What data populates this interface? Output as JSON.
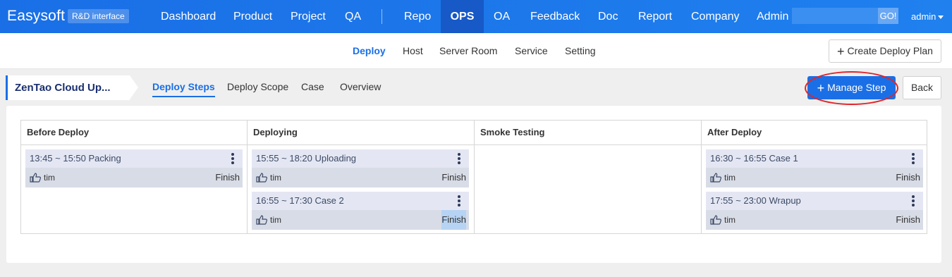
{
  "brand": {
    "name": "Easysoft",
    "badge": "R&D interface"
  },
  "nav": {
    "items": [
      "Dashboard",
      "Product",
      "Project",
      "QA",
      "Repo",
      "OPS",
      "OA",
      "Feedback",
      "Doc",
      "Report",
      "Company",
      "Admin"
    ],
    "active": "OPS",
    "search_go": "GO!",
    "user": "admin"
  },
  "subnav": {
    "items": [
      "Deploy",
      "Host",
      "Server Room",
      "Service",
      "Setting"
    ],
    "active": "Deploy",
    "create_button": "Create Deploy Plan"
  },
  "plan": {
    "title": "ZenTao Cloud Up...",
    "tabs": [
      "Deploy Steps",
      "Deploy Scope",
      "Case",
      "Overview"
    ],
    "active_tab": "Deploy Steps",
    "manage_button": "Manage Step",
    "back_button": "Back"
  },
  "columns": [
    {
      "title": "Before Deploy",
      "steps": [
        {
          "time": "13:45 ~ 15:50 Packing",
          "owner": "tim",
          "status": "Finish"
        }
      ]
    },
    {
      "title": "Deploying",
      "steps": [
        {
          "time": "15:55 ~ 18:20 Uploading",
          "owner": "tim",
          "status": "Finish"
        },
        {
          "time": "16:55 ~ 17:30 Case 2",
          "owner": "tim",
          "status": "Finish"
        }
      ]
    },
    {
      "title": "Smoke Testing",
      "steps": []
    },
    {
      "title": "After Deploy",
      "steps": [
        {
          "time": "16:30 ~ 16:55 Case 1",
          "owner": "tim",
          "status": "Finish"
        },
        {
          "time": "17:55 ~ 23:00 Wrapup",
          "owner": "tim",
          "status": "Finish"
        }
      ]
    }
  ],
  "colors": {
    "primary": "#1a6fe6",
    "highlight_ring": "#e0252a",
    "card": "#d8dce6"
  }
}
